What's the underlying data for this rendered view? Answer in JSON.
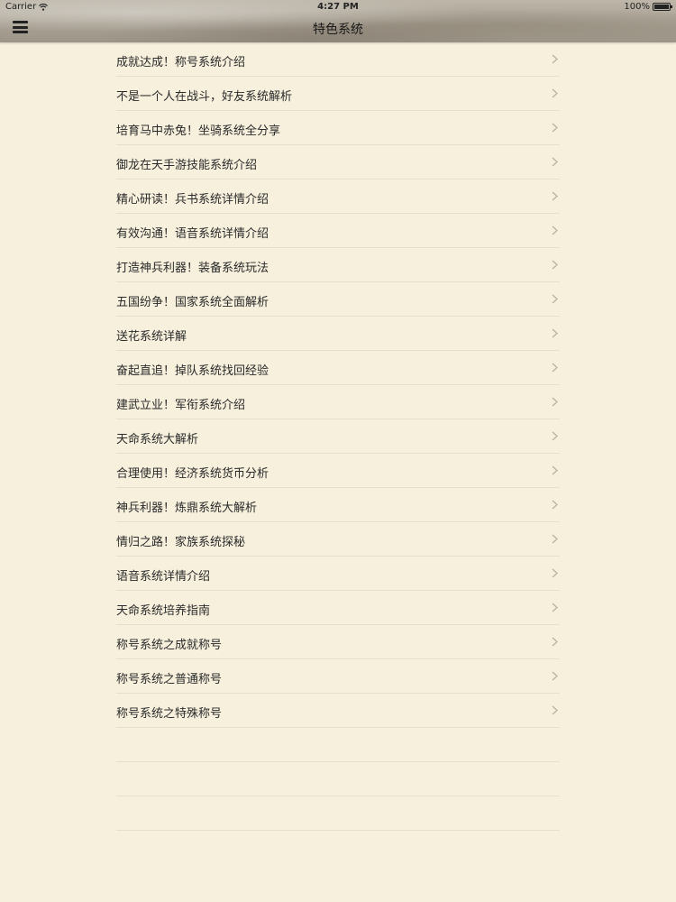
{
  "status_bar": {
    "carrier": "Carrier",
    "time": "4:27 PM",
    "battery": "100%"
  },
  "nav": {
    "title": "特色系统",
    "menu_icon": "hamburger-menu-icon"
  },
  "list": {
    "items": [
      {
        "label": "成就达成！称号系统介绍"
      },
      {
        "label": "不是一个人在战斗，好友系统解析"
      },
      {
        "label": "培育马中赤兔！坐骑系统全分享"
      },
      {
        "label": "御龙在天手游技能系统介绍"
      },
      {
        "label": "精心研读！兵书系统详情介绍"
      },
      {
        "label": "有效沟通！语音系统详情介绍"
      },
      {
        "label": "打造神兵利器！装备系统玩法"
      },
      {
        "label": "五国纷争！国家系统全面解析"
      },
      {
        "label": "送花系统详解"
      },
      {
        "label": "奋起直追！掉队系统找回经验"
      },
      {
        "label": "建武立业！军衔系统介绍"
      },
      {
        "label": "天命系统大解析"
      },
      {
        "label": "合理使用！经济系统货币分析"
      },
      {
        "label": "神兵利器！炼鼎系统大解析"
      },
      {
        "label": "情归之路！家族系统探秘"
      },
      {
        "label": "语音系统详情介绍"
      },
      {
        "label": "天命系统培养指南"
      },
      {
        "label": "称号系统之成就称号"
      },
      {
        "label": "称号系统之普通称号"
      },
      {
        "label": "称号系统之特殊称号"
      }
    ]
  },
  "colors": {
    "background": "#f7f0dd",
    "separator": "#e7dfca",
    "text": "#2a2a2a",
    "chevron": "#b9b2a2"
  }
}
